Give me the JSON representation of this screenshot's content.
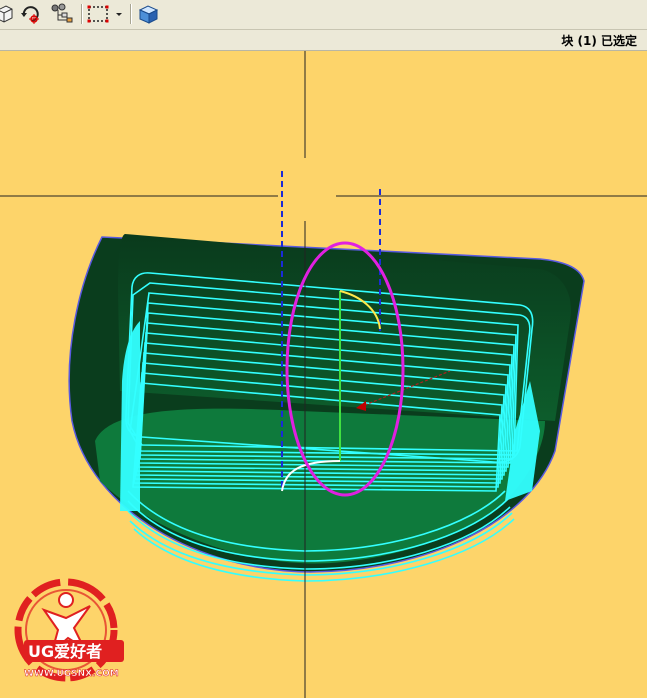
{
  "toolbar": {
    "buttons": [
      {
        "icon": "view-cube-icon"
      },
      {
        "icon": "rotate-icon"
      },
      {
        "icon": "snap-point-icon"
      },
      {
        "icon": "assembly-tree-icon"
      },
      {
        "icon": "selection-box-icon"
      },
      {
        "icon": "dropdown-arrow-icon"
      },
      {
        "icon": "shaded-block-icon"
      }
    ]
  },
  "status": {
    "text": "块 (1) 已选定"
  },
  "colors": {
    "background": "#fdd46a",
    "part_dark": "#0a4a1e",
    "part_floor": "#0e7a3c",
    "toolpath": "#33ffff",
    "highlight_ellipse": "#e020e0",
    "boundary": "#5a5ae0"
  },
  "logo": {
    "brand": "UG爱好者",
    "url": "WWW.UGSNX.COM"
  }
}
